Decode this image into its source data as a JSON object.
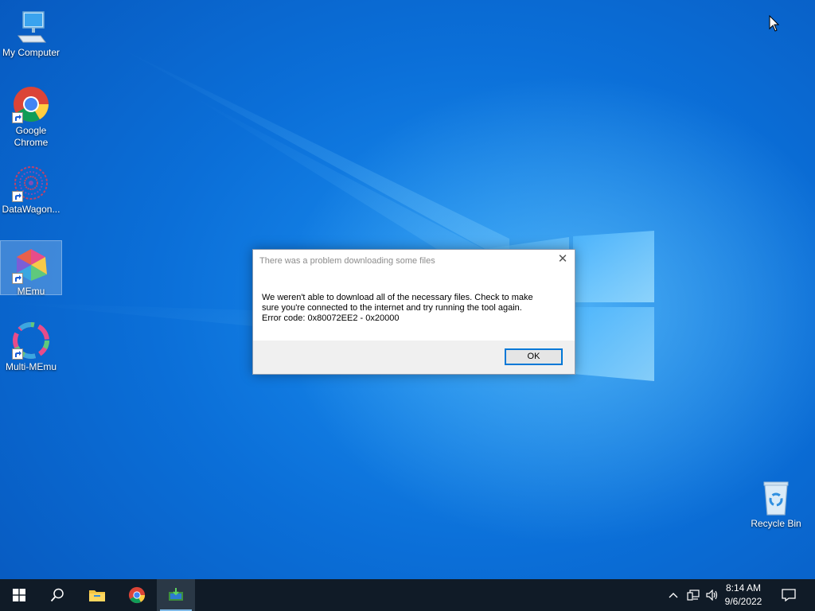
{
  "desktop": {
    "icons": [
      {
        "label": "My Computer",
        "icon": "computer-icon"
      },
      {
        "label": "Google\nChrome",
        "icon": "chrome-icon"
      },
      {
        "label": "DataWagon...",
        "icon": "datawagon-icon"
      },
      {
        "label": "MEmu",
        "icon": "memu-icon"
      },
      {
        "label": "Multi-MEmu",
        "icon": "multi-memu-icon"
      },
      {
        "label": "Recycle Bin",
        "icon": "recycle-bin-icon"
      }
    ]
  },
  "dialog": {
    "title": "There was a problem downloading some files",
    "message_line1": "We weren't able to download all of the necessary files. Check to make",
    "message_line2": "sure you're connected to the internet and try running the tool again.",
    "message_line3": "Error code: 0x80072EE2 - 0x20000",
    "ok_label": "OK",
    "close_glyph": "✕"
  },
  "taskbar": {
    "items": [
      "start-icon",
      "search-icon",
      "file-explorer-icon",
      "chrome-icon",
      "media-creation-tool-icon"
    ],
    "tray": [
      "chevron-up-icon",
      "network-icon",
      "volume-icon"
    ],
    "time": "8:14 AM",
    "date": "9/6/2022",
    "notifications": "action-center-icon"
  },
  "colors": {
    "accent": "#0078d7",
    "taskbar": "#101b27",
    "desktop": "#0b6fd8"
  }
}
